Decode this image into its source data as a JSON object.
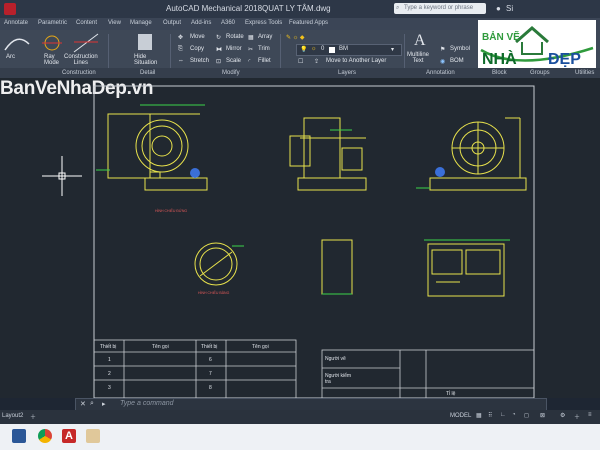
{
  "titlebar": {
    "app_title": "AutoCAD Mechanical 2018",
    "file_name": "QUAT LY TÂM.dwg",
    "search_placeholder": "Type a keyword or phrase",
    "user_label": "Si"
  },
  "menu": [
    "Annotate",
    "Parametric",
    "Content",
    "View",
    "Manage",
    "Output",
    "Add-ins",
    "A360",
    "Express Tools",
    "Featured Apps"
  ],
  "ribbon": {
    "arc": "Arc",
    "ray_mode": "Ray\nMode",
    "construction_lines": "Construction\nLines",
    "hide_situation": "Hide\nSituation",
    "move": "Move",
    "rotate": "Rotate",
    "array": "Array",
    "copy": "Copy",
    "mirror": "Mirror",
    "trim": "Trim",
    "stretch": "Stretch",
    "scale": "Scale",
    "fillet": "Fillet",
    "layer_name": "0",
    "layer_value": "BM",
    "move_to_layer": "Move to Another Layer",
    "multiline_text": "Multiline\nText",
    "symbol": "Symbol",
    "bom": "BOM",
    "panel_labels": [
      "Construction",
      "Detail",
      "Modify",
      "Layers",
      "Annotation",
      "Block",
      "Groups",
      "Utilities"
    ]
  },
  "logo": {
    "line1": "BẢN VẼ",
    "line2": "NHÀ",
    "line3": "ĐẸP"
  },
  "watermark": "BanVeNhaDep.vn",
  "drawing": {
    "caption_front": "HÌNH CHIẾU ĐỨNG",
    "caption_side": "HÌNH CHIẾU BẰNG",
    "parts_table": {
      "headers": [
        "Thiết bị",
        "Tên gọi",
        "Thiết bị",
        "Tên gọi"
      ],
      "rows": [
        [
          "1",
          "",
          "6",
          ""
        ],
        [
          "2",
          "",
          "7",
          ""
        ],
        [
          "3",
          "",
          "8",
          ""
        ]
      ]
    },
    "title_block": {
      "drawn_by": "Người vẽ",
      "checked_by": "Người kiểm\ntra",
      "scale": "Tỉ lệ"
    }
  },
  "command": {
    "placeholder": "Type a command"
  },
  "layout_tab": "Layout2",
  "status": {
    "model": "MODEL"
  },
  "taskbar_icons": [
    "word-icon",
    "chrome-icon",
    "autocad-icon",
    "paint-icon"
  ]
}
